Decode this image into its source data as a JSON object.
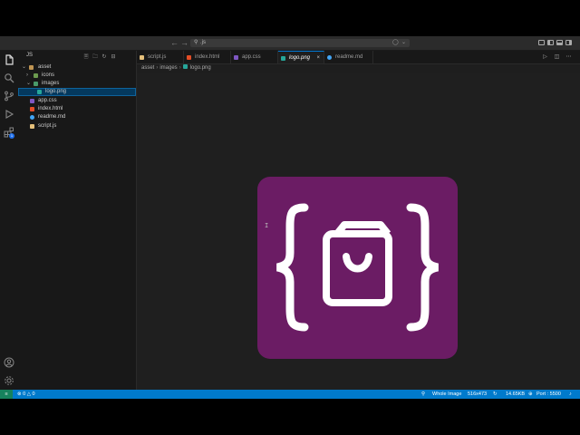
{
  "titlebar": {
    "search_text": ".js",
    "back_icon": "arrow-left-icon",
    "forward_icon": "arrow-right-icon"
  },
  "sidebar": {
    "title": "JS",
    "actions": [
      "new-file-icon",
      "new-folder-icon",
      "refresh-icon",
      "collapse-icon"
    ],
    "tree": [
      {
        "label": "asset",
        "type": "folder",
        "expanded": true,
        "depth": 0
      },
      {
        "label": "icons",
        "type": "folder",
        "expanded": false,
        "depth": 1
      },
      {
        "label": "images",
        "type": "folder",
        "expanded": true,
        "depth": 1
      },
      {
        "label": "logo.png",
        "type": "image",
        "depth": 2,
        "selected": true
      },
      {
        "label": "app.css",
        "type": "css",
        "depth": 0
      },
      {
        "label": "index.html",
        "type": "html",
        "depth": 0
      },
      {
        "label": "readme.md",
        "type": "md",
        "depth": 0
      },
      {
        "label": "script.js",
        "type": "js",
        "depth": 0
      }
    ]
  },
  "tabs": [
    {
      "label": "script.js",
      "type": "js"
    },
    {
      "label": "index.html",
      "type": "html"
    },
    {
      "label": "app.css",
      "type": "css"
    },
    {
      "label": "logo.png",
      "type": "image",
      "active": true,
      "close": "×"
    },
    {
      "label": "readme.md",
      "type": "md"
    }
  ],
  "breadcrumb": {
    "parts": [
      "asset",
      "images",
      "logo.png"
    ]
  },
  "activity": {
    "badge": "1"
  },
  "statusbar": {
    "errors": "0",
    "warnings": "0",
    "zoom_label": "Whole Image",
    "dimensions": "516x473",
    "size": "14.65KB",
    "port": "Port : 5500"
  },
  "colors": {
    "logo_bg": "#6b1c64",
    "status_bg": "#007acc",
    "selection": "#04395e"
  }
}
